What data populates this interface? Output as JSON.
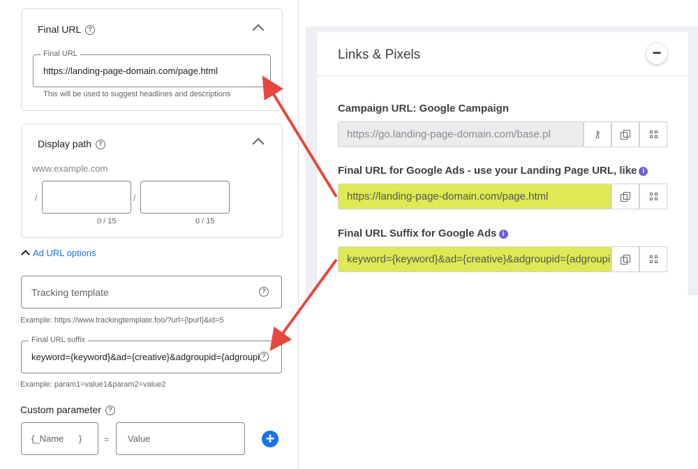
{
  "left": {
    "final_url_card": {
      "title": "Final URL",
      "field_label": "Final URL",
      "field_value": "https://landing-page-domain.com/page.html",
      "hint": "This will be used to suggest headlines and descriptions"
    },
    "display_path_card": {
      "title": "Display path",
      "domain": "www.example.com",
      "slash": "/",
      "path1_counter": "0 / 15",
      "path2_counter": "0 / 15"
    },
    "ad_url_options": {
      "toggle_label": "Ad URL options",
      "tracking_template_placeholder": "Tracking template",
      "tracking_example": "Example: https://www.trackingtemplate.foo/?url={lpurl}&id=5",
      "suffix_label": "Final URL suffix",
      "suffix_value": "keyword={keyword}&ad={creative}&adgroupid={adgroupid}",
      "suffix_example": "Example: param1=value1&param2=value2",
      "custom_param_title": "Custom parameter",
      "name_placeholder": "{_Name      }",
      "equals": "=",
      "value_placeholder": "Value",
      "add_symbol": "+"
    }
  },
  "right": {
    "title": "Links & Pixels",
    "collapse_symbol": "−",
    "campaign_url": {
      "label": "Campaign URL: Google Campaign",
      "value": "https://go.landing-page-domain.com/base.pl"
    },
    "final_url_ads": {
      "label": "Final URL for Google Ads - use your Landing Page URL, like",
      "value": "https://landing-page-domain.com/page.html"
    },
    "final_url_suffix": {
      "label": "Final URL Suffix for Google Ads",
      "value": "keyword={keyword}&ad={creative}&adgroupid={adgroupid}"
    },
    "info_symbol": "i",
    "highlight_color": "#dfe953",
    "arrow_color": "#e8473f"
  },
  "icons": {
    "help": "?",
    "key": "🔑"
  }
}
